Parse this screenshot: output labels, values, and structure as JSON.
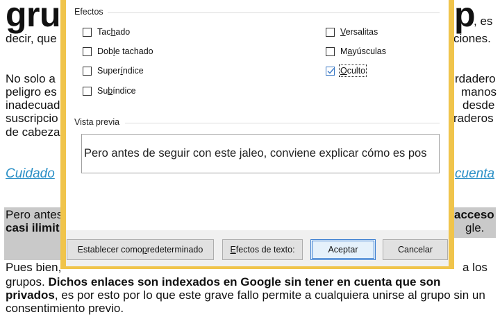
{
  "document": {
    "title_left": "gru",
    "title_right": "p",
    "title_tail": ", es",
    "line1_left": "decir, que",
    "line1_right": "ciones.",
    "para2": [
      {
        "left": "No solo a",
        "right": "rdadero"
      },
      {
        "left": "peligro es",
        "right": "manos"
      },
      {
        "left": "inadecuad",
        "right": "desde"
      },
      {
        "left": "suscripcio",
        "right": "raderos"
      },
      {
        "left": "de cabeza",
        "right": ""
      }
    ],
    "link_left": "Cuidado",
    "link_right": "cuenta",
    "shaded_line1_left": "Pero antes",
    "shaded_line1_right": "acceso",
    "shaded_line2_left": "casi ilimit",
    "shaded_line2_right": "gle.",
    "para3_line1_left": "Pues bien,",
    "para3_line1_right": "a los",
    "para3_line2_normal": "grupos. ",
    "para3_line2_bold": "Dichos enlaces son indexados en Google sin tener en cuenta que son",
    "para3_line3_bold": "privados",
    "para3_line3_normal": ", es por esto por lo que este grave fallo permite a cualquiera unirse al grupo sin un",
    "para3_line4": "consentimiento previo."
  },
  "dialog": {
    "effects_group": "Efectos",
    "checkboxes": {
      "tachado": {
        "pre": "Tac",
        "key": "h",
        "post": "ado",
        "checked": false
      },
      "doble_tachado": {
        "pre": "Dob",
        "key": "l",
        "post": "e tachado",
        "checked": false
      },
      "superindice": {
        "pre": "Super",
        "key": "í",
        "post": "ndice",
        "checked": false
      },
      "subindice": {
        "pre": "Su",
        "key": "b",
        "post": "índice",
        "checked": false
      },
      "versalitas": {
        "pre": "",
        "key": "V",
        "post": "ersalitas",
        "checked": false
      },
      "mayusculas": {
        "pre": "M",
        "key": "a",
        "post": "yúsculas",
        "checked": false
      },
      "oculto": {
        "pre": "",
        "key": "O",
        "post": "culto",
        "checked": true
      }
    },
    "preview_group": "Vista previa",
    "preview_text": "Pero antes de seguir con este jaleo, conviene explicar cómo es pos",
    "buttons": {
      "set_default": {
        "pre": "Establecer como ",
        "key": "p",
        "post": "redeterminado"
      },
      "text_effects": {
        "pre": "",
        "key": "E",
        "post": "fectos de texto:"
      },
      "accept": "Aceptar",
      "cancel": "Cancelar"
    },
    "colors": {
      "frame": "#f0c44b",
      "accent": "#3c7fd1",
      "link": "#2a8fc6"
    }
  }
}
